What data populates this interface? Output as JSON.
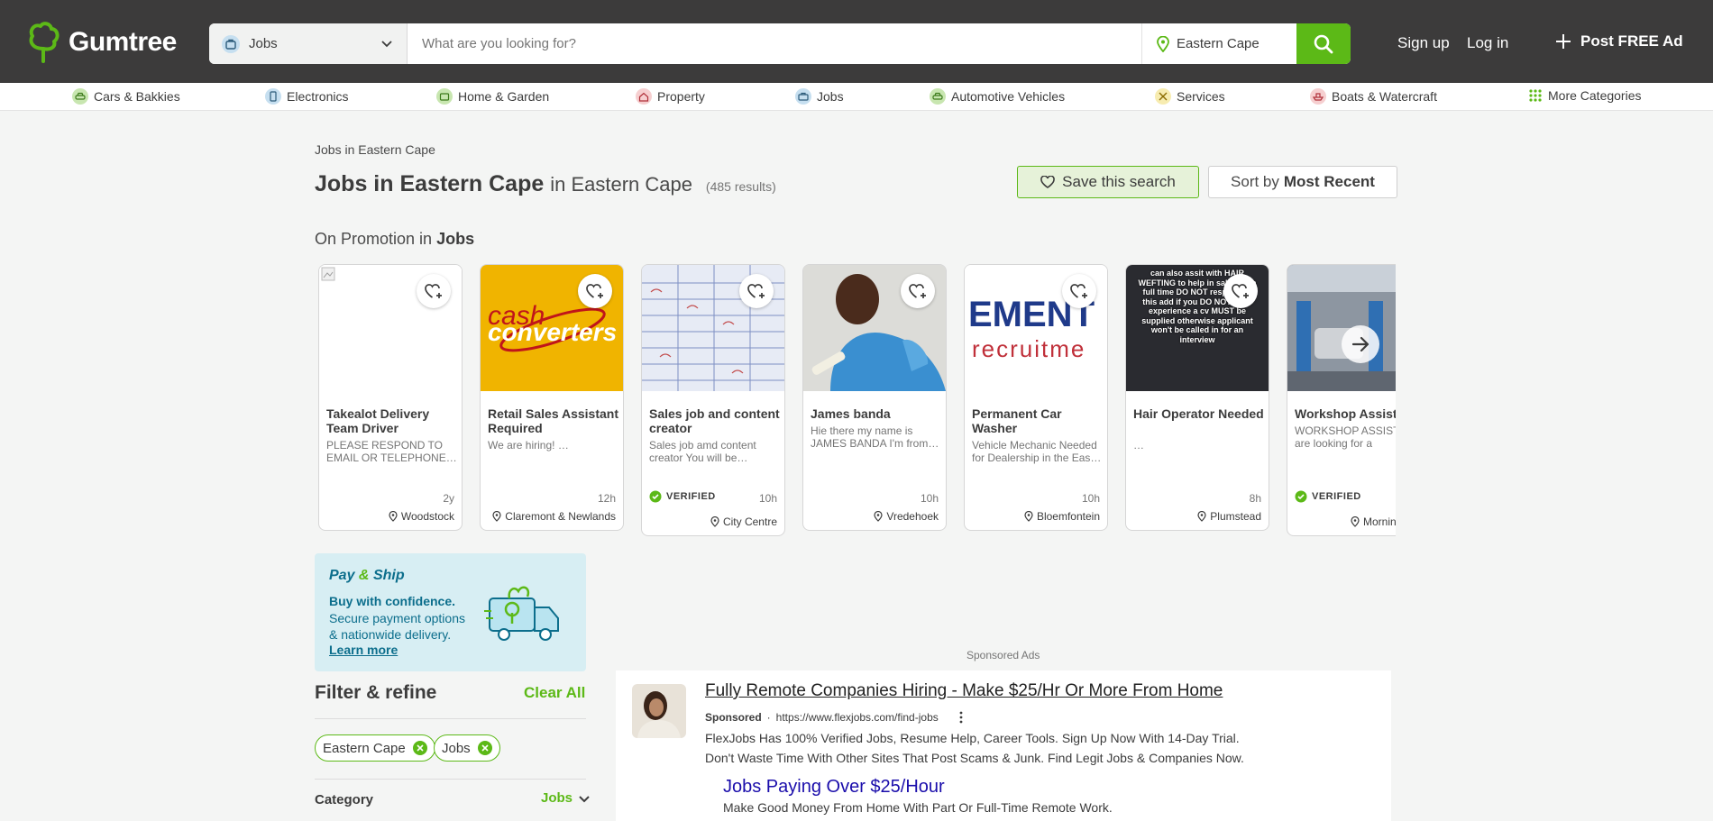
{
  "header": {
    "logo_text": "Gumtree",
    "category_select": "Jobs",
    "search_placeholder": "What are you looking for?",
    "location": "Eastern Cape",
    "sign_up": "Sign up",
    "log_in": "Log in",
    "post_ad": "Post FREE Ad"
  },
  "categories": [
    {
      "label": "Cars & Bakkies",
      "color": "#c8e6b0"
    },
    {
      "label": "Electronics",
      "color": "#c6dff0"
    },
    {
      "label": "Home & Garden",
      "color": "#c8e6b0"
    },
    {
      "label": "Property",
      "color": "#f6cfd0"
    },
    {
      "label": "Jobs",
      "color": "#c6dff0"
    },
    {
      "label": "Automotive Vehicles",
      "color": "#c8e6b0"
    },
    {
      "label": "Services",
      "color": "#f7ecb0"
    },
    {
      "label": "Boats & Watercraft",
      "color": "#f6cfd0"
    },
    {
      "label": "More Categories",
      "color": "#5cb917"
    }
  ],
  "main": {
    "breadcrumb": "Jobs in Eastern Cape",
    "title": "Jobs in Eastern Cape",
    "title_location": "in Eastern Cape",
    "result_count": "(485 results)",
    "save_search": "Save this search",
    "sort_prefix": "Sort by",
    "sort_value": "Most Recent",
    "promo_prefix": "On Promotion in",
    "promo_category": "Jobs"
  },
  "listings": [
    {
      "title": "Takealot Delivery Team Driver Partner…",
      "desc": "PLEASE RESPOND TO EMAIL OR TELEPHONE…",
      "time": "2y",
      "location": "Woodstock",
      "verified": false
    },
    {
      "title": "Retail Sales Assistant Required",
      "desc": "We are hiring! …",
      "time": "12h",
      "location": "Claremont & Newlands",
      "verified": false
    },
    {
      "title": "Sales job and content creator",
      "desc": "Sales job amd content creator You will be…",
      "time": "10h",
      "location": "City Centre",
      "verified": true
    },
    {
      "title": "James banda",
      "desc": "Hie there my name is JAMES BANDA I'm from…",
      "time": "10h",
      "location": "Vredehoek",
      "verified": false
    },
    {
      "title": "Permanent Car Washer",
      "desc": "Vehicle Mechanic Needed for Dealership in the Eas…",
      "time": "10h",
      "location": "Bloemfontein",
      "verified": false
    },
    {
      "title": "Hair Operator Needed",
      "desc": "…",
      "time": "8h",
      "location": "Plumstead",
      "verified": false
    },
    {
      "title": "Workshop Assista",
      "desc": "WORKSHOP ASSIST - We are looking for a",
      "time": "",
      "location": "Mornin",
      "verified": true
    }
  ],
  "image_text": {
    "cash_top": "cash",
    "cash_bottom": "converters",
    "ement_top": "EMENT",
    "ement_bottom": "recruitme",
    "hair_text": "can also assit with HAIR WEFTING to help in salon on a full time DO NOT respond to this add if you DO NOT have experience a cv MUST be supplied otherwise applicant won't be called in for an interview"
  },
  "verified_label": "VERIFIED",
  "payship": {
    "title_pay": "Pay",
    "title_amp": "&",
    "title_ship": "Ship",
    "line1": "Buy with confidence.",
    "body": "Secure payment options & nationwide delivery.",
    "link": "Learn more"
  },
  "filter": {
    "title": "Filter & refine",
    "clear_all": "Clear All",
    "chips": [
      "Eastern Cape",
      "Jobs"
    ],
    "category_label": "Category",
    "category_value": "Jobs"
  },
  "sponsored": {
    "label": "Sponsored Ads",
    "headline": "Fully Remote Companies Hiring - Make $25/Hr Or More From Home",
    "sponsored_tag": "Sponsored",
    "url": "https://www.flexjobs.com/find-jobs",
    "desc1": "FlexJobs Has 100% Verified Jobs, Resume Help, Career Tools. Sign Up Now With 14-Day Trial.",
    "desc2": "Don't Waste Time With Other Sites That Post Scams & Junk. Find Legit Jobs & Companies Now.",
    "sitelink": "Jobs Paying Over $25/Hour",
    "sitelink_desc": "Make Good Money From Home With Part Or Full-Time Remote Work."
  },
  "colors": {
    "brand_green": "#5cb917",
    "header_bg": "#3c3b3b",
    "payship_blue": "#0c6e8c"
  }
}
